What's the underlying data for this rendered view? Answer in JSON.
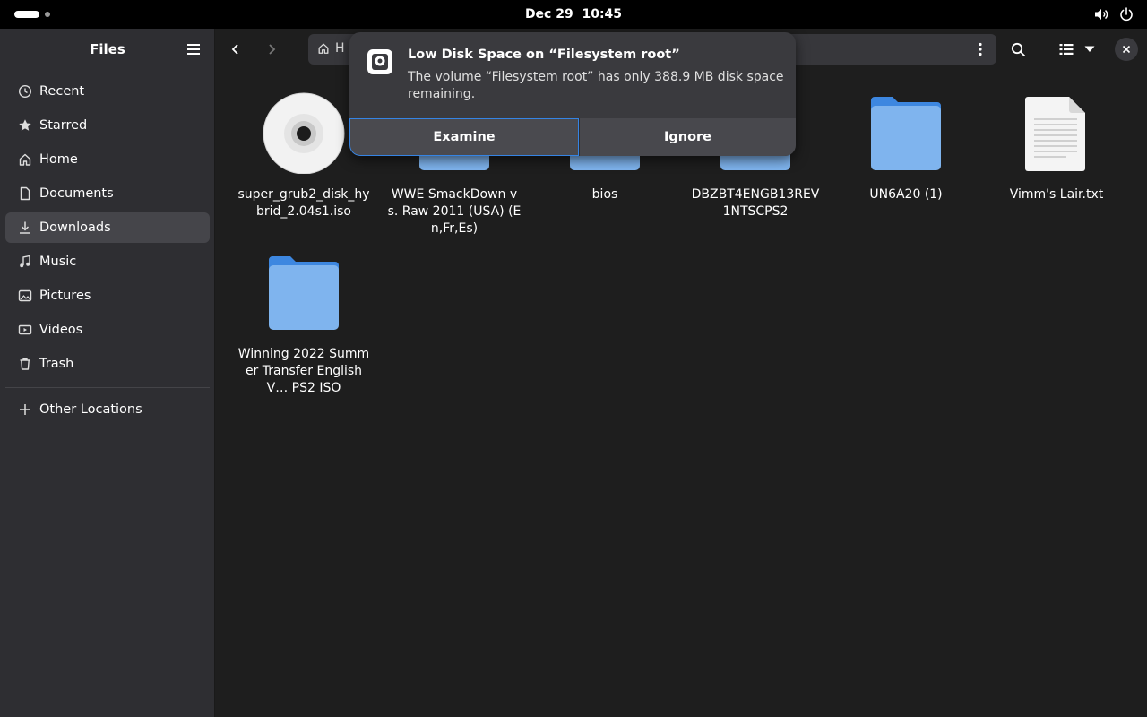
{
  "topbar": {
    "clock_date": "Dec 29",
    "clock_time": "10:45",
    "icons": [
      "activities-indicator",
      "volume-icon",
      "power-icon"
    ]
  },
  "sidebar": {
    "title": "Files",
    "items": [
      {
        "label": "Recent",
        "icon": "clock-icon"
      },
      {
        "label": "Starred",
        "icon": "star-icon"
      },
      {
        "label": "Home",
        "icon": "home-icon"
      },
      {
        "label": "Documents",
        "icon": "document-icon"
      },
      {
        "label": "Downloads",
        "icon": "download-icon",
        "active": true
      },
      {
        "label": "Music",
        "icon": "music-icon"
      },
      {
        "label": "Pictures",
        "icon": "picture-icon"
      },
      {
        "label": "Videos",
        "icon": "video-icon"
      },
      {
        "label": "Trash",
        "icon": "trash-icon"
      }
    ],
    "other_locations": "Other Locations"
  },
  "pathbar": {
    "home_label": "H"
  },
  "files": [
    {
      "name": "super_grub2_disk_hybrid_2.04s1.iso",
      "type": "disc"
    },
    {
      "name": "WWE SmackDown vs. Raw 2011 (USA) (En,Fr,Es)",
      "type": "folder"
    },
    {
      "name": "bios",
      "type": "folder"
    },
    {
      "name": "DBZBT4ENGB13REV1NTSCPS2",
      "type": "folder"
    },
    {
      "name": "UN6A20 (1)",
      "type": "folder"
    },
    {
      "name": "Vimm's Lair.txt",
      "type": "text"
    },
    {
      "name": "Winning 2022 Summer Transfer English V… PS2 ISO",
      "type": "folder"
    }
  ],
  "notification": {
    "title": "Low Disk Space on “Filesystem root”",
    "body": "The volume “Filesystem root” has only 388.9 MB disk space remaining.",
    "examine_label": "Examine",
    "ignore_label": "Ignore"
  },
  "colors": {
    "accent": "#3584e4",
    "folder": "#7fb4ee",
    "folder_tab": "#3d87e0"
  }
}
